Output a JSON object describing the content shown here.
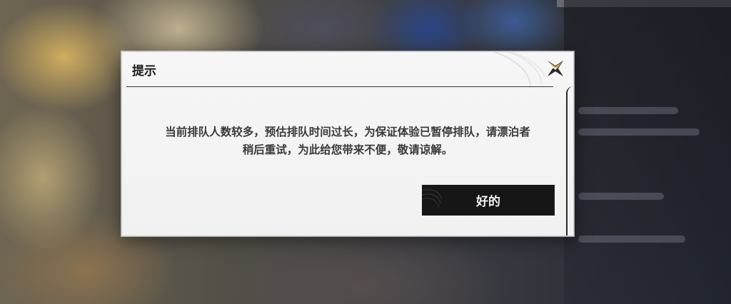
{
  "dialog": {
    "title": "提示",
    "message_line1": "当前排队人数较多，预估排队时间过长，为保证体验已暂停排队，请漂泊者",
    "message_line2": "稍后重试，为此给您带来不便，敬请谅解。",
    "confirm_label": "好的",
    "close_icon": "close-icon"
  },
  "colors": {
    "dialog_bg": "#f4f4f4",
    "button_bg": "#161616",
    "button_text": "#f2f2f2",
    "text": "#3a3a3a"
  }
}
